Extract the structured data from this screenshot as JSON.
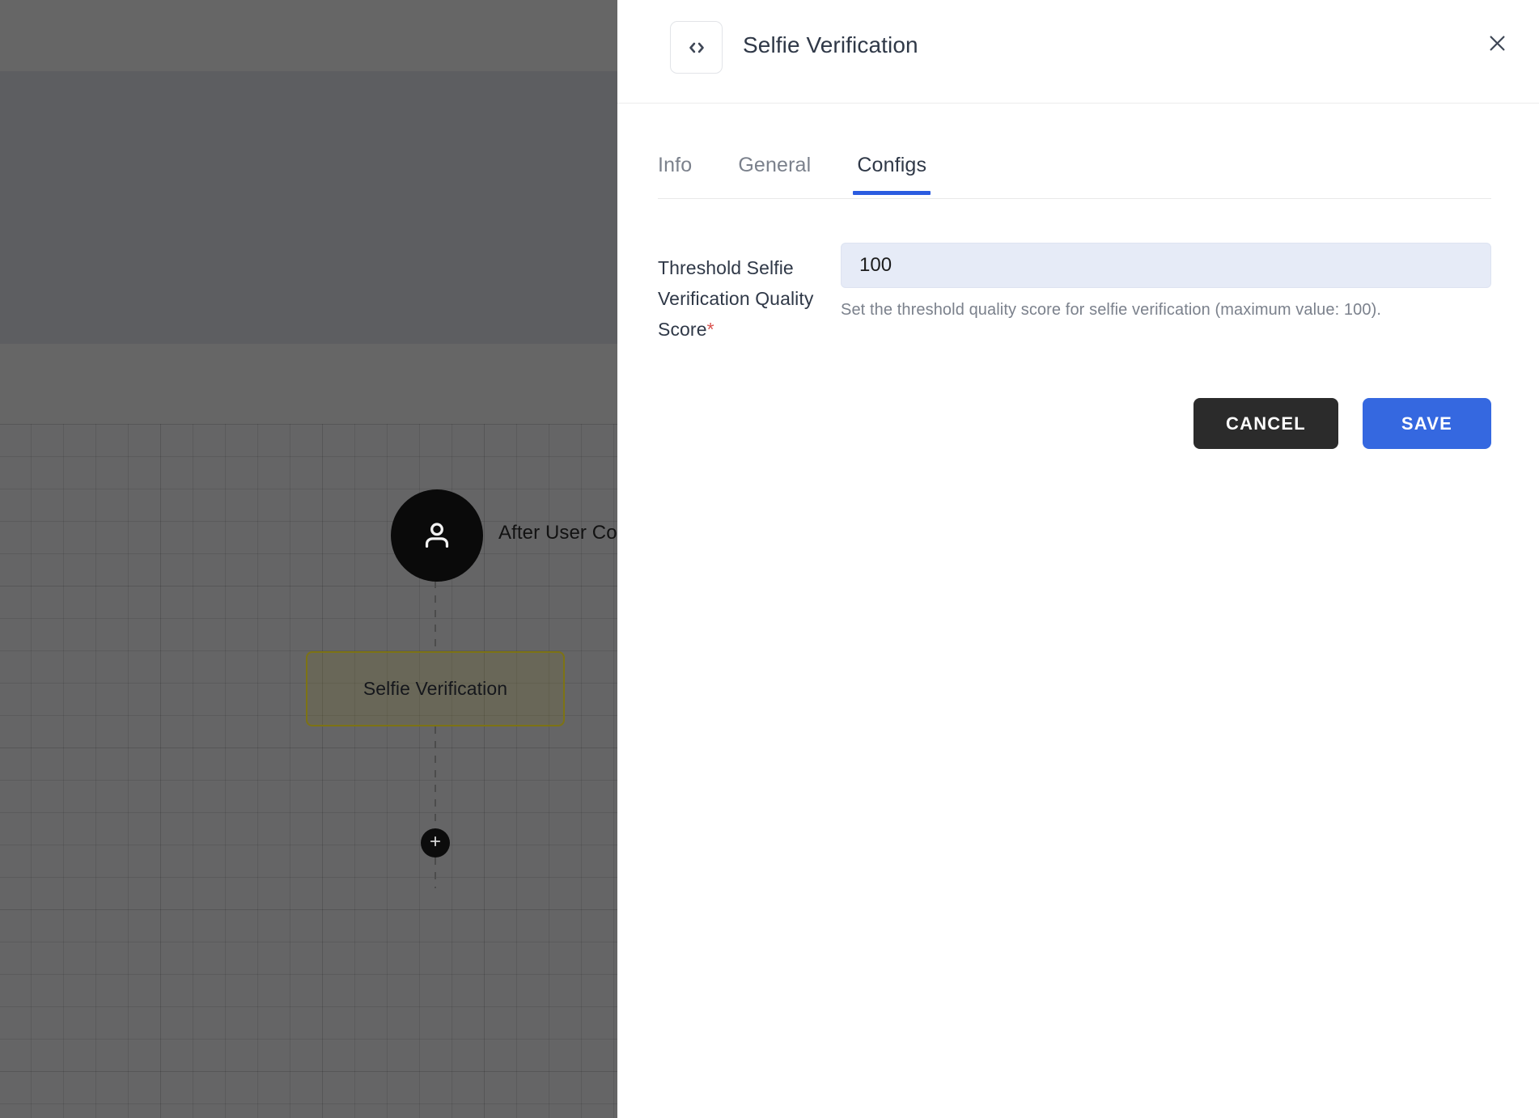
{
  "panel": {
    "icon": "code-icon",
    "title": "Selfie Verification",
    "close_icon": "close-icon",
    "tabs": [
      {
        "label": "Info",
        "active": false
      },
      {
        "label": "General",
        "active": false
      },
      {
        "label": "Configs",
        "active": true
      }
    ],
    "form": {
      "field_label": "Threshold Selfie Verification Quality Score",
      "required_marker": "*",
      "input_value": "100",
      "input_placeholder": "",
      "help_text": "Set the threshold quality score for selfie verification (maximum value: 100)."
    },
    "actions": {
      "cancel_label": "CANCEL",
      "save_label": "SAVE"
    },
    "colors": {
      "accent": "#2b5ce0",
      "save_button": "#3568e0",
      "cancel_button": "#2b2b2b",
      "input_background": "#e6ebf7",
      "required": "#d9534f",
      "title_text": "#2f3847",
      "muted_text": "#7b818c"
    }
  },
  "canvas": {
    "start_node": {
      "icon": "user-icon",
      "label": "After User Con"
    },
    "step_node": {
      "label": "Selfie Verification",
      "border_color": "#7d7314"
    },
    "add_node_button": {
      "icon": "plus-icon"
    }
  }
}
